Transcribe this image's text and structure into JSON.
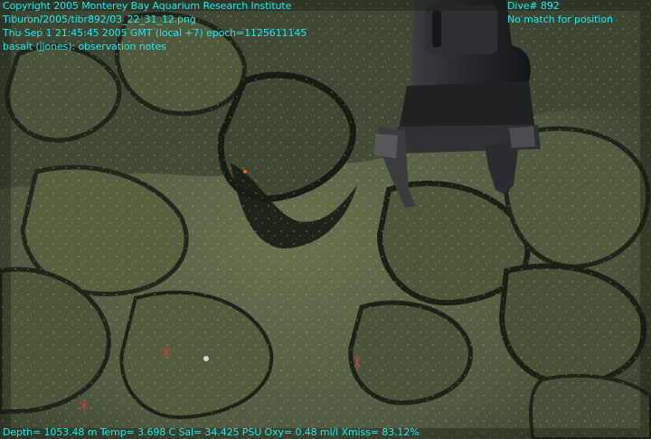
{
  "overlay": {
    "top_left": [
      "Copyright 2005 Monterey Bay Aquarium Research Institute",
      "Tiburon/2005/tibr892/03_22_31_12.png",
      "Thu Sep  1 21:45:45 2005 GMT (local +7)  epoch=1125611145",
      "basalt (jjones): observation notes"
    ],
    "top_right": [
      "Dive# 892",
      "No match for position"
    ],
    "bottom": "Depth= 1053.48 m  Temp= 3.698 C  Sal= 34.425 PSU  Oxy= 0.48 ml/l  Xmiss= 83.12%"
  },
  "colors": {
    "overlay_text": "#1fe8f0",
    "sediment": "#5b6547",
    "rock_dark": "#1e241a",
    "manipulator": "#26282a"
  }
}
